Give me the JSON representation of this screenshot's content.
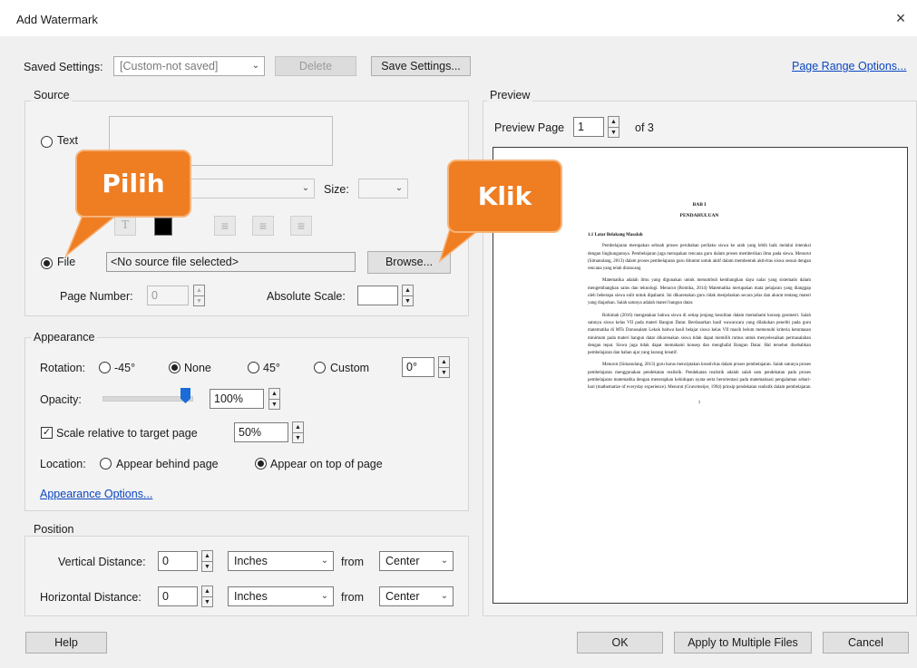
{
  "dialog": {
    "title": "Add Watermark",
    "close_glyph": "×"
  },
  "top": {
    "saved_settings_label": "Saved Settings:",
    "saved_settings_value": "[Custom-not saved]",
    "delete_label": "Delete",
    "save_settings_label": "Save Settings...",
    "page_range_link": "Page Range Options..."
  },
  "source": {
    "group_title": "Source",
    "text_radio_label": "Text",
    "size_label": "Size:",
    "file_radio_label": "File",
    "file_value": "<No source file selected>",
    "browse_label": "Browse...",
    "page_number_label": "Page Number:",
    "page_number_value": "0",
    "absolute_scale_label": "Absolute Scale:",
    "absolute_scale_value": ""
  },
  "appearance": {
    "group_title": "Appearance",
    "rotation_label": "Rotation:",
    "rotation_options": [
      "-45°",
      "None",
      "45°",
      "Custom"
    ],
    "rotation_selected": "None",
    "rotation_custom_value": "0°",
    "opacity_label": "Opacity:",
    "opacity_value": "100%",
    "opacity_level": 1.0,
    "scale_label": "Scale relative to target page",
    "scale_checked": true,
    "scale_value": "50%",
    "location_label": "Location:",
    "location_behind": "Appear behind page",
    "location_top": "Appear on top of page",
    "location_selected": "Appear on top of page",
    "options_link": "Appearance Options..."
  },
  "position": {
    "group_title": "Position",
    "vertical_label": "Vertical Distance:",
    "vertical_value": "0",
    "vertical_unit": "Inches",
    "vertical_from_label": "from",
    "vertical_from": "Center",
    "horizontal_label": "Horizontal Distance:",
    "horizontal_value": "0",
    "horizontal_unit": "Inches",
    "horizontal_from_label": "from",
    "horizontal_from": "Center"
  },
  "preview": {
    "group_title": "Preview",
    "page_label": "Preview Page",
    "page_value": "1",
    "of_label": "of 3",
    "doc": {
      "heading1": "BAB I",
      "heading2": "PENDAHULUAN",
      "section": "1.1  Latar Belakang Masalah",
      "p1": "Pembelajaran merupakan sebuah proses perubahan perilaku siswa ke arah yang lebih baik melalui interaksi dengan lingkungannya. Pembelajaran juga merupakan rencana guru dalam proses memberikan ilmu pada siswa. Menurut (Simanulang, 2013) dalam proses pembelajaran guru dituntut untuk aktif dalam membentuk aktivitas siswa sesuai dengan rencana yang telah dirancang",
      "p2": "Matematika adalah ilmu yang digunakan untuk menumbuh kembangkan daya nalar yang sistematis dalam mengembangkan sains dan teknologi. Menurut (Romika, 2014) Matematika merupakan mata pelajaran yang dianggap oleh beberapa siswa sulit untuk dipahami. Ini dikarenakan guru tidak menjelaskan secara jelas dan akurat tentang materi yang diajarkan. Salah satunya adalah materi bangun datar.",
      "p3": "Rohimah (2016) mengatakan bahwa siswa di setiap jenjang kesulitan dalam memahami konsep geometri. Salah satunya siswa kelas VII pada materi Bangun Datar. Berdasarkan hasil wawancara yang dilakukan peneliti pada guru matematika di MTs Darussalam Lekok bahwa hasil belajar siswa kelas VII masih belum memenuhi kriteria ketuntasan minimum pada materi bangun datar dikarenakan siswa tidak dapat memilih rumus untuk menyelesaikan permasalahan dengan tepat. Siswa juga tidak dapat memahami konsep dan menghafal Bangun Datar. Hal tersebut disebabkan pembelajaran dan bahan ajar yang kurang kreatif.",
      "p4": "Menurut (Simanulang, 2013) guru harus menciptakan kreativitas dalam proses pembelajaran. Salah satunya proses pembelajaran menggunakan pendekatan realistik. Pendekatan realistik adalah salah satu pendekatan pada proses pembelajaran matematika dengan menerapkan kehidupan nyata serta berorientasi pada matematisasi pengalaman sehari-hari (mathematize of everyday experience). Menurut (Gravemeijer, 1994) prinsip pendekatan realistik dalam pembelajaran",
      "page_number": "1"
    }
  },
  "bottom": {
    "help_label": "Help",
    "ok_label": "OK",
    "apply_multiple_label": "Apply to Multiple Files",
    "cancel_label": "Cancel"
  },
  "callouts": {
    "pilih": "Pilih",
    "klik": "Klik",
    "color": "#ef7d22"
  }
}
